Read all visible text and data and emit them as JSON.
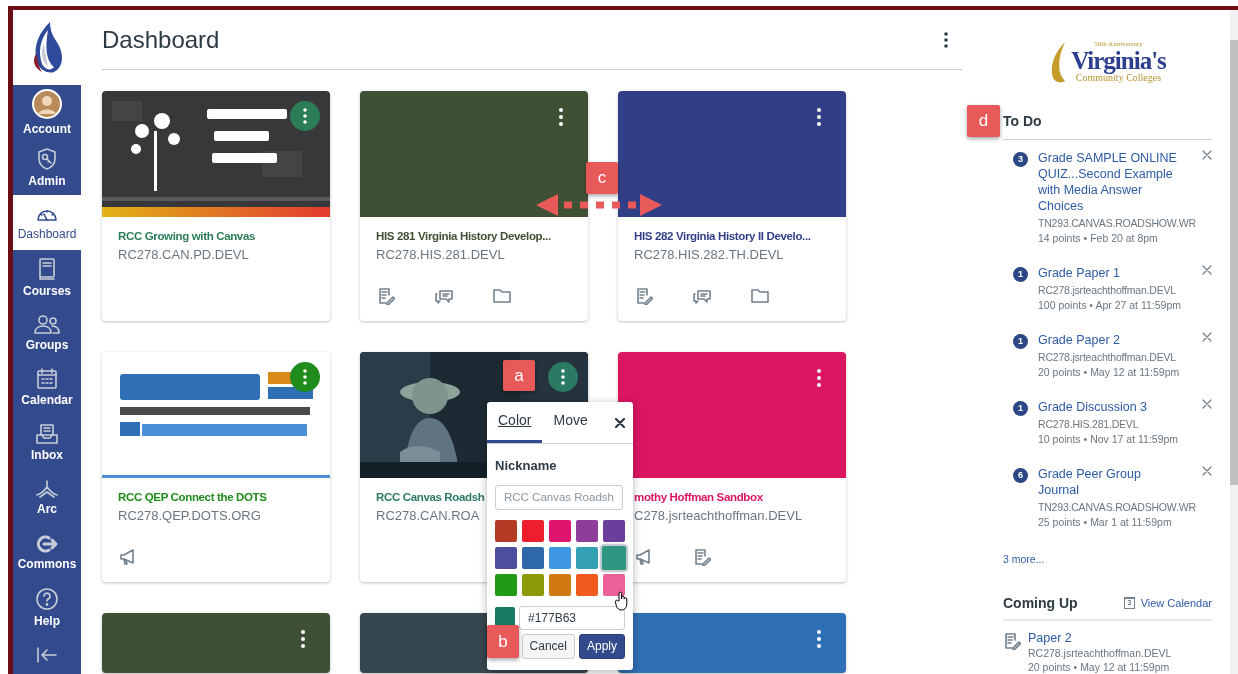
{
  "nav": {
    "items": [
      {
        "label": "Account",
        "kind": "avatar",
        "selected": false
      },
      {
        "label": "Admin",
        "kind": "admin",
        "selected": false
      },
      {
        "label": "Dashboard",
        "kind": "dashboard",
        "selected": true
      },
      {
        "label": "Courses",
        "kind": "courses",
        "selected": false
      },
      {
        "label": "Groups",
        "kind": "groups",
        "selected": false
      },
      {
        "label": "Calendar",
        "kind": "calendar",
        "selected": false
      },
      {
        "label": "Inbox",
        "kind": "inbox",
        "selected": false
      },
      {
        "label": "Arc",
        "kind": "arc",
        "selected": false
      },
      {
        "label": "Commons",
        "kind": "commons",
        "selected": false
      },
      {
        "label": "Help",
        "kind": "help",
        "selected": false
      }
    ]
  },
  "header": {
    "title": "Dashboard"
  },
  "cards": [
    {
      "title": "RCC Growing with Canvas",
      "code": "RC278.CAN.PD.DEVL",
      "color": "#2a7d57",
      "image": {
        "kind": "picture"
      },
      "menu": {
        "kind": "circle"
      }
    },
    {
      "title": "HIS 281 Virginia History Develop...",
      "code": "RC278.HIS.281.DEVL",
      "color": "#3f5134",
      "menu": {
        "kind": "plain"
      },
      "icons": [
        {
          "kind": "assignments"
        },
        {
          "kind": "discussions"
        },
        {
          "kind": "files"
        }
      ]
    },
    {
      "title": "HIS 282 Virginia History II Develo...",
      "code": "RC278.HIS.282.TH.DEVL",
      "color": "#323f86",
      "menu": {
        "kind": "plain"
      },
      "icons": [
        {
          "kind": "assignments"
        },
        {
          "kind": "discussions"
        },
        {
          "kind": "files"
        }
      ]
    },
    {
      "title": "RCC QEP Connect the DOTS",
      "code": "RC278.QEP.DOTS.ORG",
      "color": "#1f8c1c",
      "image": {
        "kind": "picture"
      },
      "menu": {
        "kind": "circle"
      },
      "icons": [
        {
          "kind": "announcements"
        }
      ]
    },
    {
      "title": "RCC Canvas Roadsh",
      "code": "RC278.CAN.ROA",
      "color": "#2b7a63",
      "image": {
        "kind": "picture"
      },
      "menu": {
        "kind": "circle"
      }
    },
    {
      "title": "mothy Hoffman Sandbox",
      "code": "C278.jsrteachthoffman.DEVL",
      "color": "#dc1563",
      "menu": {
        "kind": "plain"
      },
      "icons": [
        {
          "kind": "announcements"
        },
        {
          "kind": "assignments"
        }
      ]
    },
    {
      "color": "#3f5134",
      "menu": {
        "kind": "plain"
      }
    },
    {
      "color": "#37474f"
    },
    {
      "color": "#2f6fb5",
      "menu": {
        "kind": "plain"
      }
    }
  ],
  "popover": {
    "tabs": [
      {
        "label": "Color",
        "selected": true
      },
      {
        "label": "Move",
        "selected": false
      }
    ],
    "nickname_label": "Nickname",
    "nickname_placeholder": "RCC Canvas Roadsh",
    "swatches": [
      {
        "color": "#b43b24",
        "selected": false
      },
      {
        "color": "#ee1f2c",
        "selected": false
      },
      {
        "color": "#e0146e",
        "selected": false
      },
      {
        "color": "#8e3d9a",
        "selected": false
      },
      {
        "color": "#6a3e9a",
        "selected": false
      },
      {
        "color": "#4c4ea0",
        "selected": false
      },
      {
        "color": "#2f68a9",
        "selected": false
      },
      {
        "color": "#3f96e0",
        "selected": false
      },
      {
        "color": "#33a0b4",
        "selected": false
      },
      {
        "color": "#2f9682",
        "selected": true
      },
      {
        "color": "#219b15",
        "selected": false
      },
      {
        "color": "#8d9a08",
        "selected": false
      },
      {
        "color": "#d27a12",
        "selected": false
      },
      {
        "color": "#f25b1f",
        "selected": false
      },
      {
        "color": "#ec5f98",
        "selected": false
      }
    ],
    "hex_value": "#177B63",
    "buttons": [
      {
        "label": "Cancel",
        "kind": "secondary"
      },
      {
        "label": "Apply",
        "kind": "primary"
      }
    ]
  },
  "logo": {
    "tagline": "50th Anniversary",
    "name": "Virginia's",
    "subtitle": "Community Colleges"
  },
  "todo": {
    "title": "To Do",
    "items": [
      {
        "count": "3",
        "title": "Grade SAMPLE ONLINE QUIZ...Second Example with Media Answer Choices",
        "course": "TN293.CANVAS.ROADSHOW.WR",
        "meta": "14 points • Feb 20 at 8pm"
      },
      {
        "count": "1",
        "title": "Grade Paper 1",
        "course": "RC278.jsrteachthoffman.DEVL",
        "meta": "100 points • Apr 27 at 11:59pm"
      },
      {
        "count": "1",
        "title": "Grade Paper 2",
        "course": "RC278.jsrteachthoffman.DEVL",
        "meta": "20 points • May 12 at 11:59pm"
      },
      {
        "count": "1",
        "title": "Grade Discussion 3",
        "course": "RC278.HIS.281.DEVL",
        "meta": "10 points • Nov 17 at 11:59pm"
      },
      {
        "count": "6",
        "title": "Grade Peer Group Journal",
        "course": "TN293.CANVAS.ROADSHOW.WR",
        "meta": "25 points • Mar 1 at 11:59pm"
      }
    ],
    "more": "3 more..."
  },
  "coming_up": {
    "title": "Coming Up",
    "calendar_day": "3",
    "link": "View Calendar",
    "items": [
      {
        "title": "Paper 2",
        "course": "RC278.jsrteachthoffman.DEVL",
        "meta": "20 points • May 12 at 11:59pm"
      }
    ]
  },
  "annotations": [
    {
      "label": "a"
    },
    {
      "label": "b"
    },
    {
      "label": "c",
      "arrow": true
    },
    {
      "label": "d"
    }
  ]
}
